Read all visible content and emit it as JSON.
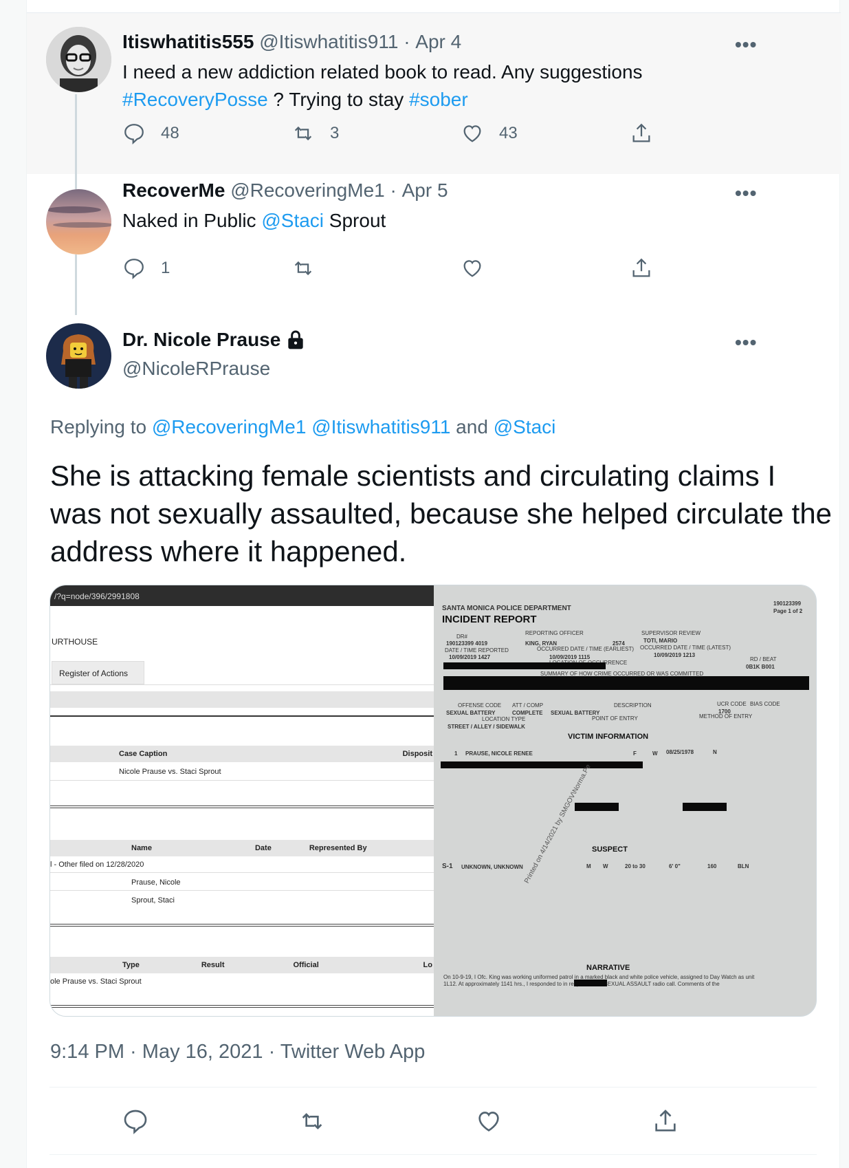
{
  "tweet1": {
    "display_name": "Itiswhatitis555",
    "handle": "@Itiswhatitis911",
    "separator": "·",
    "date": "Apr 4",
    "text_line1": "I need a new addiction related book to read.  Any suggestions",
    "hashtag1": "#RecoveryPosse",
    "text_mid": " ? Trying to stay ",
    "hashtag2": "#sober",
    "replies": "48",
    "retweets": "3",
    "likes": "43"
  },
  "tweet2": {
    "display_name": "RecoverMe",
    "handle": "@RecoveringMe1",
    "separator": "·",
    "date": "Apr 5",
    "text_before": "Naked in Public ",
    "mention": "@Staci",
    "text_after": " Sprout",
    "replies": "1"
  },
  "main_tweet": {
    "display_name": "Dr. Nicole Prause",
    "handle": "@NicoleRPrause",
    "replying_label": "Replying to ",
    "reply_mention1": "@RecoveringMe1",
    "reply_mention2": "@Itiswhatitis911",
    "reply_and": " and ",
    "reply_mention3": "@Staci",
    "text": "She is attacking female scientists and circulating claims I was not sexually assaulted, because she helped circulate the address where it happened.",
    "time": "9:14 PM",
    "date": "May 16, 2021",
    "source": "Twitter Web App",
    "separator": " · "
  },
  "media": {
    "court": {
      "url": "/?q=node/396/2991808",
      "courthouse": "URTHOUSE",
      "tab": "Register of Actions",
      "case_caption_header": "Case Caption",
      "disposition_header": "Disposit",
      "case_caption": "Nicole Prause vs. Staci Sprout",
      "name_header": "Name",
      "date_header": "Date",
      "represented_header": "Represented By",
      "other_filed": "l - Other filed on 12/28/2020",
      "party1": "Prause, Nicole",
      "party2": "Sprout, Staci",
      "type_header": "Type",
      "result_header": "Result",
      "official_header": "Official",
      "loc_header": "Lo",
      "type_row": "ole Prause vs. Staci Sprout"
    },
    "report": {
      "dept": "SANTA MONICA POLICE DEPARTMENT",
      "title": "INCIDENT REPORT",
      "report_no": "190123399",
      "page": "Page 1 of 2",
      "dr_label": "DR#",
      "dr_value": "190123399    4019",
      "officer_label": "REPORTING OFFICER",
      "officer_value": "KING, RYAN",
      "officer_id": "2574",
      "supervisor_label": "SUPERVISOR REVIEW",
      "supervisor_value": "TOTI, MARIO",
      "reported_label": "DATE / TIME REPORTED",
      "reported_value": "10/09/2019 1427",
      "occurred_label": "OCCURRED DATE / TIME (EARLIEST)",
      "occurred_value": "10/09/2019 1115",
      "latest_label": "OCCURRED DATE / TIME (LATEST)",
      "latest_value": "10/09/2019 1213",
      "location_label": "LOCATION OF OCCURRENCE",
      "beat_label": "RD / BEAT",
      "beat_value": "0B1K   B001",
      "summary_label": "SUMMARY OF HOW CRIME OCCURRED OR WAS COMMITTED",
      "offense_label": "OFFENSE CODE",
      "offense_value": "SEXUAL BATTERY",
      "attcomp_label": "ATT / COMP",
      "attcomp_value": "COMPLETE",
      "desc_label": "DESCRIPTION",
      "desc_value": "SEXUAL BATTERY",
      "ucr_label": "UCR CODE",
      "ucr_value": "1700",
      "bias_label": "BIAS CODE",
      "loc_type_label": "LOCATION TYPE",
      "loc_type_value": "STREET / ALLEY / SIDEWALK",
      "entry_label": "POINT OF ENTRY",
      "method_label": "METHOD OF ENTRY",
      "victim_header": "VICTIM INFORMATION",
      "victim_name": "PRAUSE, NICOLE RENEE",
      "victim_no": "1",
      "victim_sex": "F",
      "victim_race": "W",
      "victim_dob": "08/25/1978",
      "victim_homeless": "N",
      "suspect_header": "SUSPECT",
      "suspect_no": "S-1",
      "suspect_name": "UNKNOWN, UNKNOWN",
      "suspect_sex": "M",
      "suspect_race": "W",
      "suspect_age": "20 to 30",
      "suspect_height": "6' 0\"",
      "suspect_weight": "160",
      "suspect_hair": "BLN",
      "narrative_header": "NARRATIVE",
      "narrative_line1": "On 10-9-19, I Ofc. King was working uniformed patrol in a marked black and white police vehicle, assigned to Day Watch as unit",
      "narrative_line2": "1L12. At approximately 1141 hrs., I responded to                     in response to a SEXUAL ASSAULT radio call. Comments of the",
      "watermark": "Printed on 4/14/2021 by SMGOV\\Norma.Pe"
    }
  }
}
